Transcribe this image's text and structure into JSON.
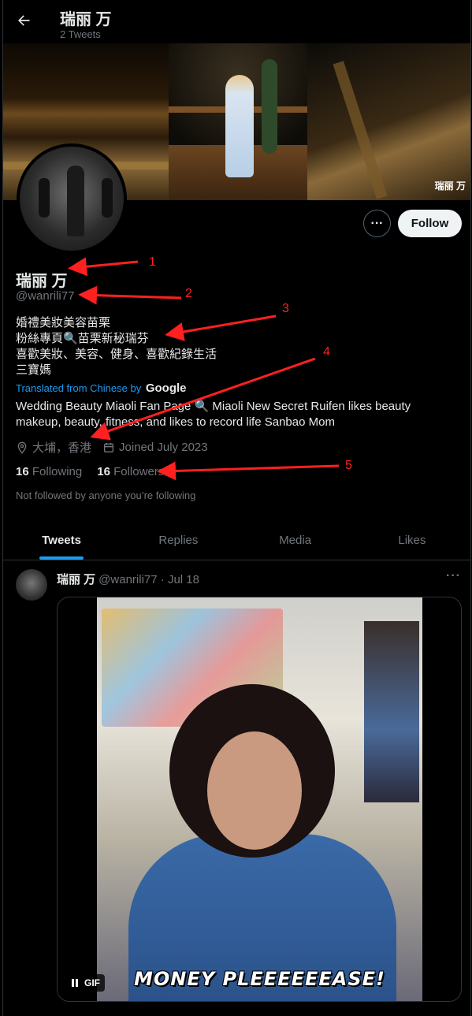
{
  "header": {
    "title": "瑞丽 万",
    "subtitle": "2 Tweets"
  },
  "banner": {
    "watermark": "瑞丽 万"
  },
  "actions": {
    "follow_label": "Follow",
    "more_label": "···"
  },
  "profile": {
    "name": "瑞丽 万",
    "handle": "@wanrili77",
    "bio_lines": [
      "婚禮美妝美容苗栗",
      "粉絲專頁🔍苗栗新秘瑞芬",
      "喜歡美妝、美容、健身、喜歡紀錄生活",
      "三寶媽"
    ],
    "translated_prefix": "Translated from Chinese by",
    "translated_provider": "Google",
    "translation": "Wedding Beauty Miaoli Fan Page 🔍 Miaoli New Secret Ruifen likes beauty makeup, beauty, fitness, and likes to record life Sanbao Mom",
    "location": "大埔，香港",
    "joined": "Joined July 2023",
    "following_count": "16",
    "following_label": "Following",
    "followers_count": "16",
    "followers_label": "Followers",
    "not_followed": "Not followed by anyone you’re following"
  },
  "tabs": [
    {
      "label": "Tweets",
      "active": true
    },
    {
      "label": "Replies",
      "active": false
    },
    {
      "label": "Media",
      "active": false
    },
    {
      "label": "Likes",
      "active": false
    }
  ],
  "tweet": {
    "name": "瑞丽 万",
    "handle": "@wanrili77",
    "separator": "·",
    "date": "Jul 18",
    "more": "···",
    "gif_caption": "MONEY PLEEEEEEASE!",
    "gif_badge": "GIF"
  },
  "annotations": {
    "n1": "1",
    "n2": "2",
    "n3": "3",
    "n4": "4",
    "n5": "5"
  },
  "colors": {
    "accent": "#1d9bf0",
    "annotation": "#ff2020",
    "background": "#000000",
    "muted": "#71767b"
  }
}
